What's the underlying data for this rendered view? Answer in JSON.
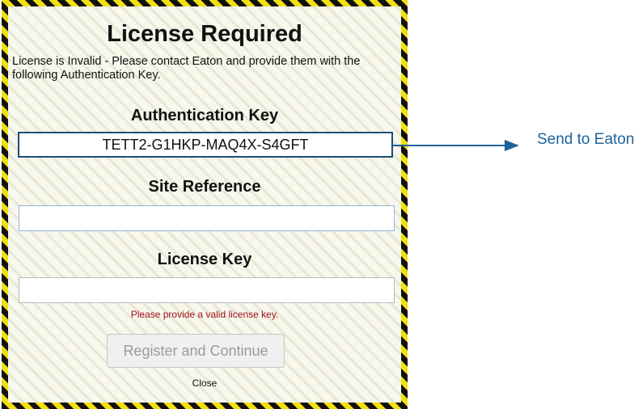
{
  "dialog": {
    "title": "License Required",
    "message": "License is Invalid - Please contact Eaton and provide them with the following Authentication Key.",
    "auth_key_label": "Authentication Key",
    "auth_key_value": "TETT2-G1HKP-MAQ4X-S4GFT",
    "site_reference_label": "Site Reference",
    "site_reference_value": "",
    "license_key_label": "License Key",
    "license_key_value": "",
    "error_message": "Please provide a valid license key.",
    "register_button_label": "Register and Continue",
    "close_label": "Close"
  },
  "annotation": {
    "label": "Send to Eaton",
    "color": "#1f6399"
  },
  "colors": {
    "hazard_stripe_dark": "#111111",
    "hazard_stripe_yellow": "#f2df0e",
    "error_text": "#a0101a",
    "auth_box_border": "#1c4f7a"
  }
}
